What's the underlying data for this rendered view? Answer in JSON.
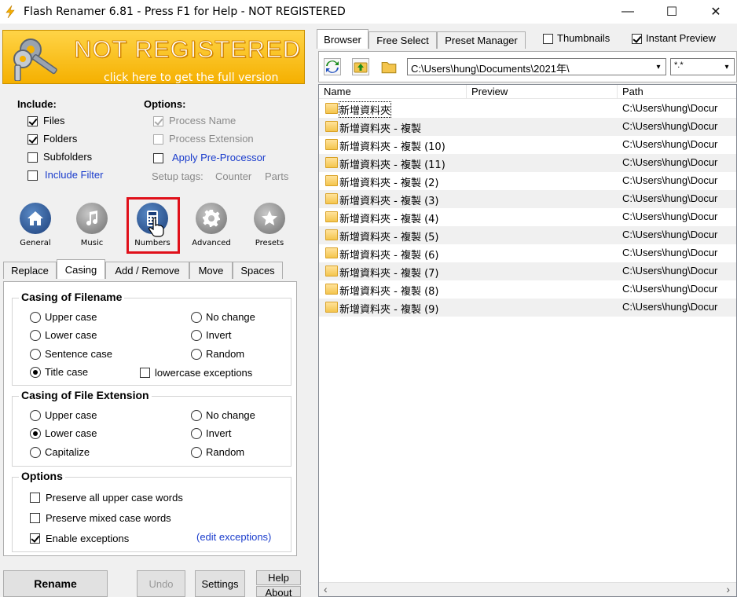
{
  "window": {
    "title": "Flash Renamer 6.81 - Press F1 for Help - NOT REGISTERED",
    "min_glyph": "—",
    "max_glyph": "☐",
    "close_glyph": "✕"
  },
  "banner": {
    "headline": "NOT REGISTERED",
    "subline": "click here to get the full version"
  },
  "include": {
    "title": "Include:",
    "files": "Files",
    "folders": "Folders",
    "subfolders": "Subfolders",
    "include_filter": "Include Filter"
  },
  "options_top": {
    "title": "Options:",
    "process_name": "Process Name",
    "process_extension": "Process Extension",
    "apply_preprocessor": "Apply Pre-Processor",
    "setup_tags": "Setup tags:",
    "counter": "Counter",
    "parts": "Parts"
  },
  "categories": {
    "general": "General",
    "music": "Music",
    "numbers": "Numbers",
    "advanced": "Advanced",
    "presets": "Presets"
  },
  "tabs": {
    "replace": "Replace",
    "casing": "Casing",
    "add_remove": "Add / Remove",
    "move": "Move",
    "spaces": "Spaces"
  },
  "casing_filename": {
    "title": "Casing of Filename",
    "upper": "Upper case",
    "lower": "Lower case",
    "sentence": "Sentence case",
    "title_case": "Title case",
    "no_change": "No change",
    "invert": "Invert",
    "random": "Random",
    "lowercase_exceptions": "lowercase exceptions"
  },
  "casing_extension": {
    "title": "Casing of File Extension",
    "upper": "Upper case",
    "lower": "Lower case",
    "capitalize": "Capitalize",
    "no_change": "No change",
    "invert": "Invert",
    "random": "Random"
  },
  "options_bottom": {
    "title": "Options",
    "preserve_upper": "Preserve all upper case words",
    "preserve_mixed": "Preserve mixed case words",
    "enable_exceptions": "Enable exceptions",
    "edit_exceptions": "(edit exceptions)"
  },
  "buttons": {
    "rename": "Rename",
    "undo": "Undo",
    "settings": "Settings",
    "help": "Help",
    "about": "About"
  },
  "right_tabs": {
    "browser": "Browser",
    "free_select": "Free Select",
    "preset_manager": "Preset Manager",
    "thumbnails": "Thumbnails",
    "instant_preview": "Instant Preview"
  },
  "path": "C:\\Users\\hung\\Documents\\2021年\\",
  "filter": "*.*",
  "columns": {
    "name": "Name",
    "preview": "Preview",
    "path": "Path"
  },
  "files": [
    {
      "name": "新增資料夾",
      "path": "C:\\Users\\hung\\Docur"
    },
    {
      "name": "新增資料夾 - 複製",
      "path": "C:\\Users\\hung\\Docur"
    },
    {
      "name": "新增資料夾 - 複製 (10)",
      "path": "C:\\Users\\hung\\Docur"
    },
    {
      "name": "新增資料夾 - 複製 (11)",
      "path": "C:\\Users\\hung\\Docur"
    },
    {
      "name": "新增資料夾 - 複製 (2)",
      "path": "C:\\Users\\hung\\Docur"
    },
    {
      "name": "新增資料夾 - 複製 (3)",
      "path": "C:\\Users\\hung\\Docur"
    },
    {
      "name": "新增資料夾 - 複製 (4)",
      "path": "C:\\Users\\hung\\Docur"
    },
    {
      "name": "新增資料夾 - 複製 (5)",
      "path": "C:\\Users\\hung\\Docur"
    },
    {
      "name": "新增資料夾 - 複製 (6)",
      "path": "C:\\Users\\hung\\Docur"
    },
    {
      "name": "新增資料夾 - 複製 (7)",
      "path": "C:\\Users\\hung\\Docur"
    },
    {
      "name": "新增資料夾 - 複製 (8)",
      "path": "C:\\Users\\hung\\Docur"
    },
    {
      "name": "新增資料夾 - 複製 (9)",
      "path": "C:\\Users\\hung\\Docur"
    }
  ]
}
